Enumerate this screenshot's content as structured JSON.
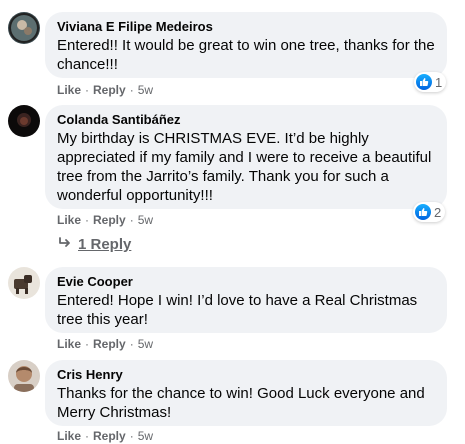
{
  "comments": [
    {
      "author": "Viviana E Filipe Medeiros",
      "text": "Entered!! It would be great to win one tree, thanks for the chance!!!",
      "like": "Like",
      "reply": "Reply",
      "time": "5w",
      "reaction_count": "1",
      "avatar_icon": "avatar-photo"
    },
    {
      "author": "Colanda Santibáñez",
      "text": "My birthday is CHRISTMAS EVE. It’d be highly appreciated if my family and I were to receive a beautiful tree from the Jarrito’s family. Thank you for such a wonderful opportunity!!!",
      "like": "Like",
      "reply": "Reply",
      "time": "5w",
      "reaction_count": "2",
      "replies_label": "1 Reply",
      "avatar_icon": "avatar-photo"
    },
    {
      "author": "Evie Cooper",
      "text": "Entered! Hope I win! I’d love to have a Real Christmas tree this year!",
      "like": "Like",
      "reply": "Reply",
      "time": "5w",
      "avatar_icon": "avatar-photo"
    },
    {
      "author": "Cris Henry",
      "text": "Thanks for the chance to win! Good Luck everyone and Merry Christmas!",
      "like": "Like",
      "reply": "Reply",
      "time": "5w",
      "avatar_icon": "avatar-photo"
    }
  ],
  "colors": {
    "bubble": "#f0f2f5",
    "meta": "#65676b",
    "like_blue": "#0571ed"
  }
}
